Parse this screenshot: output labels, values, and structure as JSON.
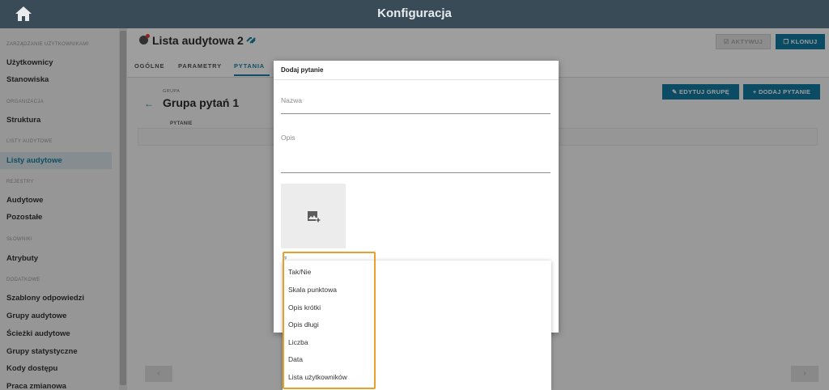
{
  "topbar": {
    "title": "Konfiguracja",
    "home_icon": "home-icon"
  },
  "sidebar": {
    "sections": [
      {
        "label": "ZARZĄDZANIE UŻYTKOWNIKAMI"
      },
      {
        "label": "ORGANIZACJA"
      },
      {
        "label": "LISTY AUDYTOWE"
      },
      {
        "label": "REJESTRY"
      },
      {
        "label": "SŁOWNIKI"
      },
      {
        "label": "DODATKOWE"
      }
    ],
    "items": [
      {
        "label": "Użytkownicy"
      },
      {
        "label": "Stanowiska"
      },
      {
        "label": "Struktura"
      },
      {
        "label": "Listy audytowe"
      },
      {
        "label": "Audytowe"
      },
      {
        "label": "Pozostałe"
      },
      {
        "label": "Atrybuty"
      },
      {
        "label": "Szablony odpowiedzi"
      },
      {
        "label": "Grupy audytowe"
      },
      {
        "label": "Ścieżki audytowe"
      },
      {
        "label": "Grupy statystyczne"
      },
      {
        "label": "Kody dostępu"
      },
      {
        "label": "Praca zmianowa"
      }
    ],
    "active_item": "Listy audytowe"
  },
  "header": {
    "title": "Lista audytowa 2",
    "activate_label": "AKTYWUJ",
    "clone_label": "KLONUJ"
  },
  "tabs": [
    {
      "label": "OGÓLNE"
    },
    {
      "label": "PARAMETRY"
    },
    {
      "label": "PYTANIA",
      "active": true
    }
  ],
  "group": {
    "label": "GRUPA",
    "title": "Grupa pytań 1",
    "edit_button": "EDYTUJ GRUPĘ",
    "add_button": "DODAJ PYTANIE",
    "column_header": "PYTANIE"
  },
  "modal": {
    "title": "Dodaj pytanie",
    "name_label": "Nazwa",
    "description_label": "Opis",
    "type_label": "yp"
  },
  "dropdown": {
    "options": [
      "Tak/Nie",
      "Skala punktowa",
      "Opis krótki",
      "Opis długi",
      "Liczba",
      "Data",
      "Lista użytkowników"
    ]
  },
  "colors": {
    "topbar": "#394b57",
    "accent": "#1379a0",
    "highlight": "#e8a02a",
    "active_sidebar_bg": "#d8e4ea"
  }
}
